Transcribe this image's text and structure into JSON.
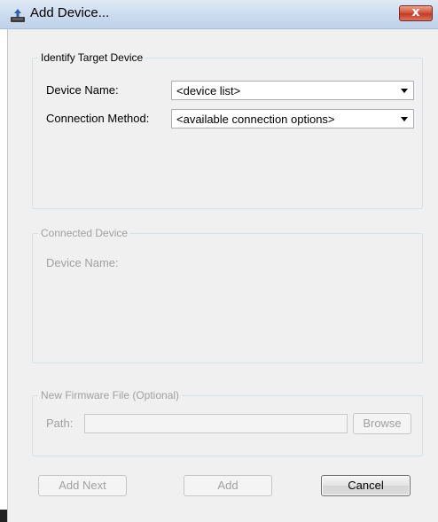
{
  "window": {
    "title": "Add Device...",
    "close_glyph": "x",
    "app_icon": "device-download-icon"
  },
  "identify_group": {
    "legend": "Identify Target Device",
    "device_name_label": "Device Name:",
    "device_name_value": "<device list>",
    "connection_label": "Connection Method:",
    "connection_value": "<available connection options>"
  },
  "connected_group": {
    "legend": "Connected Device",
    "device_name_label": "Device Name:"
  },
  "firmware_group": {
    "legend": "New Firmware File (Optional)",
    "path_label": "Path:",
    "path_value": "",
    "browse_label": "Browse"
  },
  "buttons": {
    "add_next": "Add Next",
    "add": "Add",
    "cancel": "Cancel"
  },
  "colors": {
    "title_bar": "#c9daee",
    "close_button": "#c33a22",
    "dialog_background": "#f0f0f0",
    "disabled_text": "#a0a0a0"
  }
}
